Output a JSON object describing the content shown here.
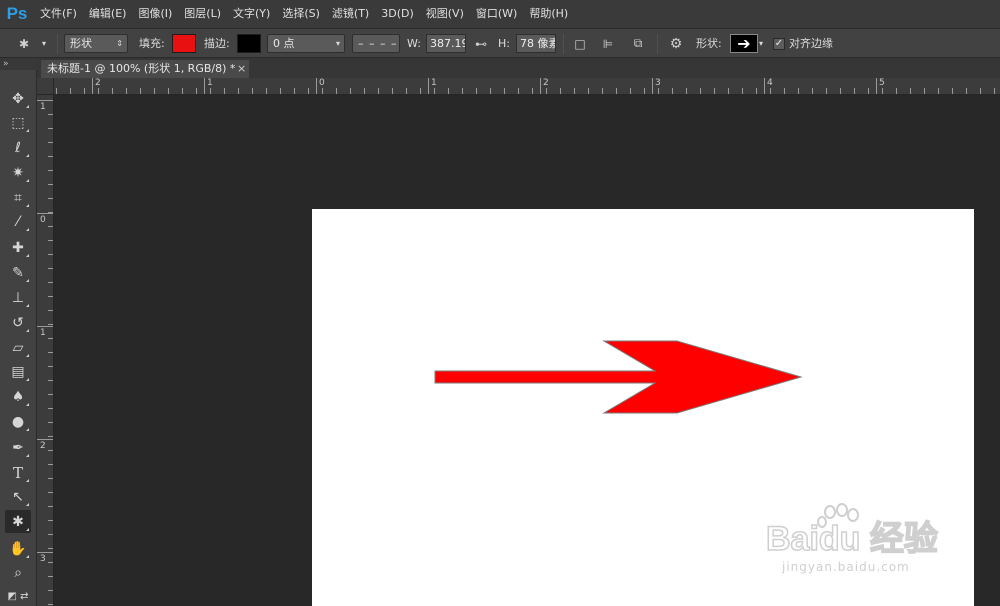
{
  "app": {
    "logo": "Ps"
  },
  "menu": [
    "文件(F)",
    "编辑(E)",
    "图像(I)",
    "图层(L)",
    "文字(Y)",
    "选择(S)",
    "滤镜(T)",
    "3D(D)",
    "视图(V)",
    "窗口(W)",
    "帮助(H)"
  ],
  "options": {
    "mode_value": "形状",
    "fill_label": "填充:",
    "fill_color": "#e81010",
    "stroke_label": "描边:",
    "stroke_color": "#000000",
    "stroke_width_value": "0 点",
    "width_label": "W:",
    "width_value": "387.19",
    "height_label": "H:",
    "height_value": "78 像素",
    "shape_label": "形状:",
    "align_edges_label": "对齐边缘",
    "align_edges_checked": true
  },
  "document": {
    "tab_title": "未标题-1 @ 100% (形状 1, RGB/8) *",
    "close_glyph": "×",
    "shape_fill_color": "#ff0000",
    "shape_stroke_color": "#7a7a7a"
  },
  "rulers": {
    "horizontal_labels": [
      "2",
      "1",
      "0",
      "1",
      "2",
      "3",
      "4",
      "5"
    ],
    "vertical_labels": [
      "1",
      "0",
      "1",
      "2",
      "3"
    ]
  },
  "watermark": {
    "brand": "Baidu 经验",
    "url": "jingyan.baidu.com"
  }
}
